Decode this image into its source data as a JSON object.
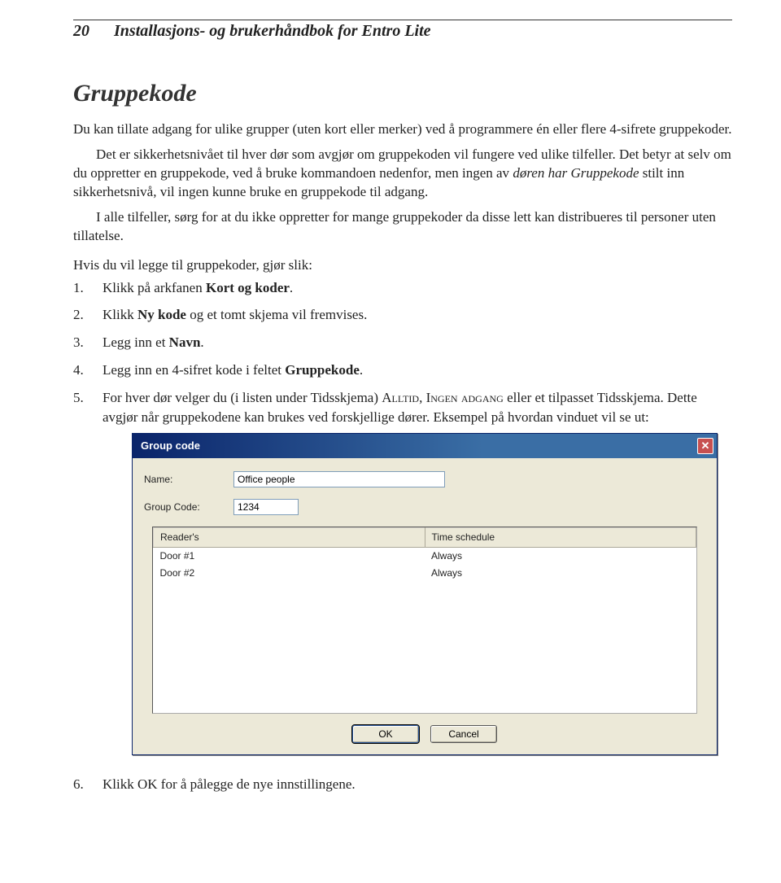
{
  "header": {
    "page_number": "20",
    "doc_title": "Installasjons- og brukerhåndbok for Entro Lite"
  },
  "section": {
    "heading": "Gruppekode",
    "para1_a": "Du kan tillate adgang for ulike grupper (uten kort eller merker) ved å programmere én eller flere 4-sifrete gruppekoder.",
    "para2_a": "Det er sikkerhetsnivået til hver dør som avgjør om gruppekoden vil fungere ved ulike tilfeller. Det betyr at selv om du oppretter en gruppekode, ved å bruke kommandoen nedenfor, men ingen av ",
    "para2_italic": "døren har Gruppekode",
    "para2_b": " stilt inn sikkerhetsnivå, vil ingen kunne bruke en gruppekode til adgang.",
    "para3": "I alle tilfeller, sørg for at du ikke oppretter for mange gruppekoder da disse lett kan distribueres til personer uten tillatelse.",
    "sub_heading": "Hvis du vil legge til gruppekoder, gjør slik:",
    "step1_a": "Klikk på arkfanen ",
    "step1_bold": "Kort og koder",
    "step1_b": ".",
    "step2_a": "Klikk ",
    "step2_bold": "Ny kode",
    "step2_b": " og et tomt skjema vil fremvises.",
    "step3_a": "Legg inn et ",
    "step3_bold": "Navn",
    "step3_b": ".",
    "step4_a": "Legg inn en 4-sifret kode i feltet ",
    "step4_bold": "Gruppekode",
    "step4_b": ".",
    "step5_a": "For hver dør velger du (i listen under Tidsskjema) ",
    "step5_sc1": "Alltid",
    "step5_mid1": ", ",
    "step5_sc2": "Ingen adgang",
    "step5_mid2": " eller et tilpasset Tidsskjema. Dette avgjør når gruppekodene kan brukes ved forskjellige dører. Eksempel på hvordan vinduet vil se ut:",
    "step6": "Klikk OK for å pålegge de nye innstillingene."
  },
  "dialog": {
    "title": "Group code",
    "name_label": "Name:",
    "name_value": "Office people",
    "code_label": "Group Code:",
    "code_value": "1234",
    "table": {
      "col_readers": "Reader's",
      "col_schedule": "Time schedule",
      "rows": [
        {
          "reader": "Door #1",
          "schedule": "Always"
        },
        {
          "reader": "Door #2",
          "schedule": "Always"
        }
      ]
    },
    "ok": "OK",
    "cancel": "Cancel"
  }
}
